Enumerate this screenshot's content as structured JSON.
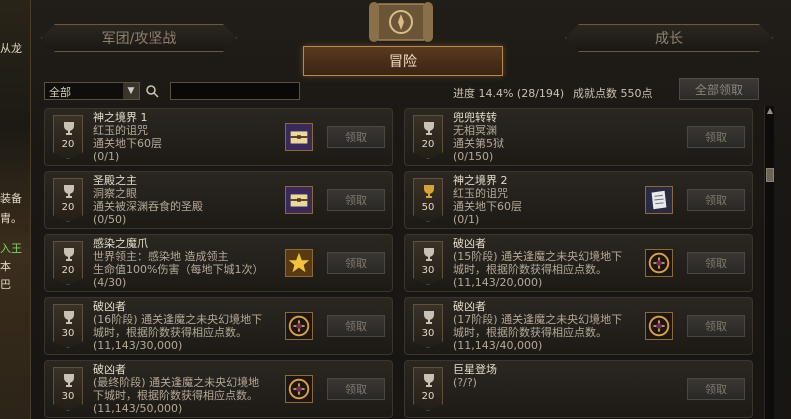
{
  "background_fragments": [
    "从龙",
    "装备",
    "胄。",
    "入王",
    "本",
    "巴"
  ],
  "tabs": {
    "left": "军团/攻坚战",
    "main": "冒险",
    "right": "成长"
  },
  "filter": {
    "selected": "全部",
    "search_placeholder": ""
  },
  "progress": "进度 14.4% (28/194)",
  "points": "成就点数 550点",
  "claim_all_label": "全部领取",
  "claim_label": "领取",
  "cards": [
    {
      "score": "20",
      "title": "神之境界 1",
      "lines": [
        "红玉的诅咒",
        "通关地下60层"
      ],
      "count": "(0/1)",
      "reward": "treasure-chest-icon"
    },
    {
      "score": "20",
      "title": "兜兜转转",
      "lines": [
        "无相冥渊",
        "通关第5狱"
      ],
      "count": "(0/150)",
      "reward": ""
    },
    {
      "score": "20",
      "title": "圣殿之主",
      "lines": [
        "洞察之眼",
        "通关被深渊吞食的圣殿"
      ],
      "count": "(0/50)",
      "reward": "treasure-chest-icon"
    },
    {
      "score": "50",
      "title": "神之境界 2",
      "lines": [
        "红玉的诅咒",
        "通关地下60层"
      ],
      "count": "(0/1)",
      "reward": "scroll-paper-icon"
    },
    {
      "score": "20",
      "title": "感染之魔爪",
      "lines": [
        "世界领主：感染地        造成领主",
        "生命值100%伤害（每地下城1次）"
      ],
      "count": "(4/30)",
      "reward": "golden-star-icon"
    },
    {
      "score": "30",
      "title": "破凶者",
      "lines": [
        "(15阶段) 通关逢魔之未央幻境地下",
        "城时，根据阶数获得相应点数。"
      ],
      "count": "(11,143/20,000)",
      "reward": "emblem-icon"
    },
    {
      "score": "30",
      "title": "破凶者",
      "lines": [
        "(16阶段) 通关逢魔之未央幻境地下",
        "城时，根据阶数获得相应点数。"
      ],
      "count": "(11,143/30,000)",
      "reward": "emblem-icon"
    },
    {
      "score": "30",
      "title": "破凶者",
      "lines": [
        "(17阶段) 通关逢魔之未央幻境地下",
        "城时，根据阶数获得相应点数。"
      ],
      "count": "(11,143/40,000)",
      "reward": "emblem-icon"
    },
    {
      "score": "30",
      "title": "破凶者",
      "lines": [
        "(最终阶段) 通关逢魔之未央幻境地",
        "下城时，根据阶数获得相应点数。"
      ],
      "count": "(11,143/50,000)",
      "reward": "emblem-icon"
    },
    {
      "score": "20",
      "title": "巨星登场",
      "lines": [
        "(?/?)"
      ],
      "count": "",
      "reward": ""
    }
  ]
}
